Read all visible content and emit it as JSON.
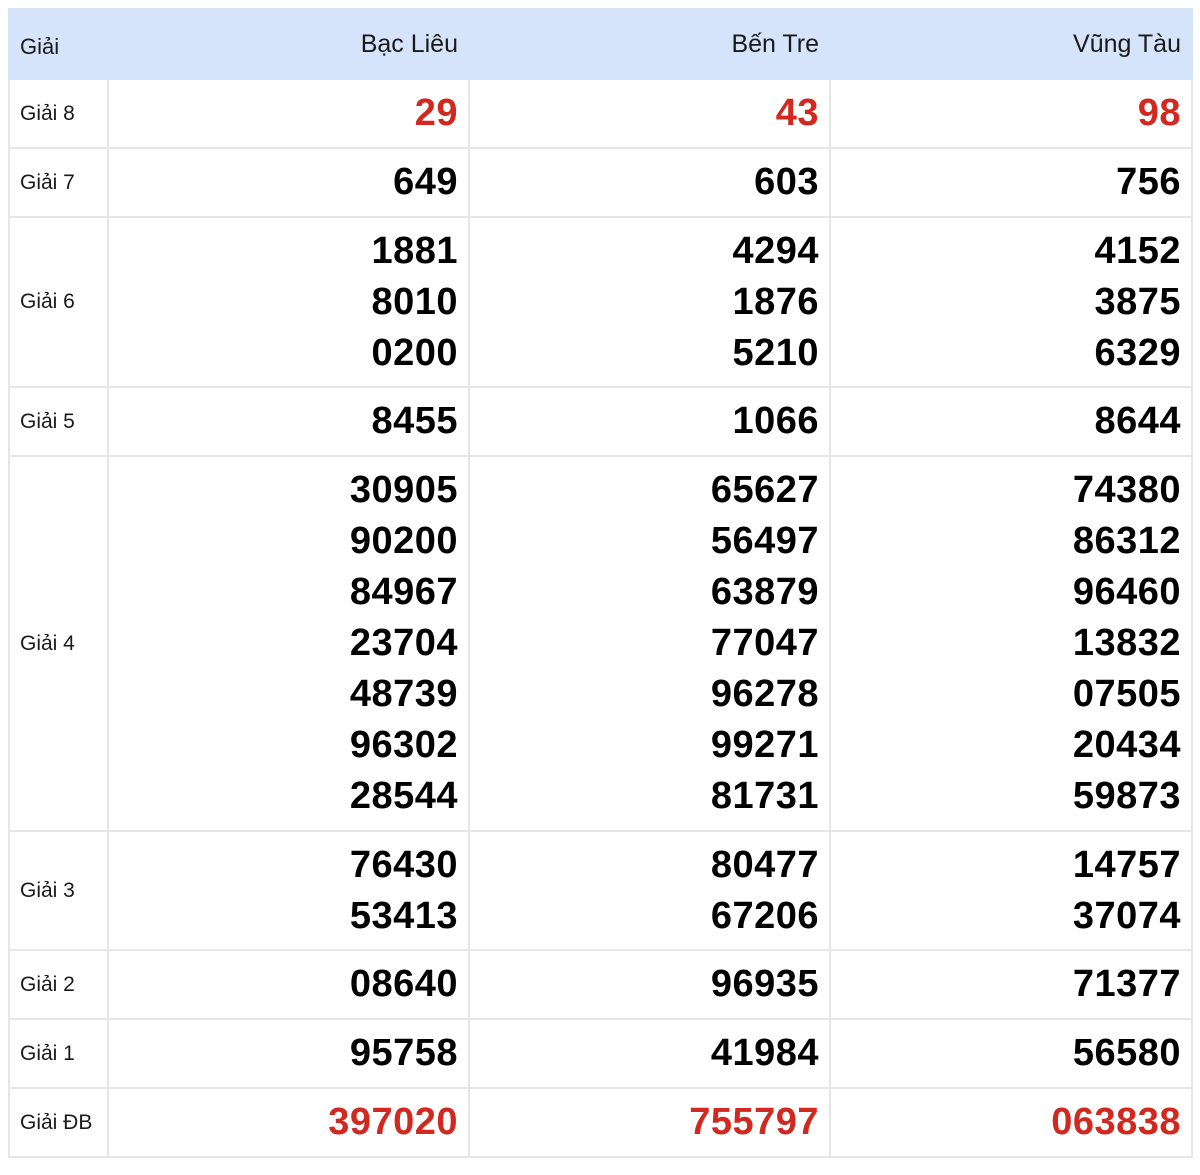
{
  "header": {
    "label": "Giải",
    "provinces": [
      "Bạc Liêu",
      "Bến Tre",
      "Vũng Tàu"
    ]
  },
  "colors": {
    "header_bg": "#d5e3fb",
    "highlight_red": "#d1281f",
    "border": "#e6e6e6"
  },
  "rows": [
    {
      "name": "Giải 8",
      "highlight": true,
      "values": [
        [
          "29"
        ],
        [
          "43"
        ],
        [
          "98"
        ]
      ]
    },
    {
      "name": "Giải 7",
      "highlight": false,
      "values": [
        [
          "649"
        ],
        [
          "603"
        ],
        [
          "756"
        ]
      ]
    },
    {
      "name": "Giải 6",
      "highlight": false,
      "values": [
        [
          "1881",
          "8010",
          "0200"
        ],
        [
          "4294",
          "1876",
          "5210"
        ],
        [
          "4152",
          "3875",
          "6329"
        ]
      ]
    },
    {
      "name": "Giải 5",
      "highlight": false,
      "values": [
        [
          "8455"
        ],
        [
          "1066"
        ],
        [
          "8644"
        ]
      ]
    },
    {
      "name": "Giải 4",
      "highlight": false,
      "values": [
        [
          "30905",
          "90200",
          "84967",
          "23704",
          "48739",
          "96302",
          "28544"
        ],
        [
          "65627",
          "56497",
          "63879",
          "77047",
          "96278",
          "99271",
          "81731"
        ],
        [
          "74380",
          "86312",
          "96460",
          "13832",
          "07505",
          "20434",
          "59873"
        ]
      ]
    },
    {
      "name": "Giải 3",
      "highlight": false,
      "values": [
        [
          "76430",
          "53413"
        ],
        [
          "80477",
          "67206"
        ],
        [
          "14757",
          "37074"
        ]
      ]
    },
    {
      "name": "Giải 2",
      "highlight": false,
      "values": [
        [
          "08640"
        ],
        [
          "96935"
        ],
        [
          "71377"
        ]
      ]
    },
    {
      "name": "Giải 1",
      "highlight": false,
      "values": [
        [
          "95758"
        ],
        [
          "41984"
        ],
        [
          "56580"
        ]
      ]
    },
    {
      "name": "Giải ĐB",
      "highlight": true,
      "values": [
        [
          "397020"
        ],
        [
          "755797"
        ],
        [
          "063838"
        ]
      ]
    }
  ]
}
